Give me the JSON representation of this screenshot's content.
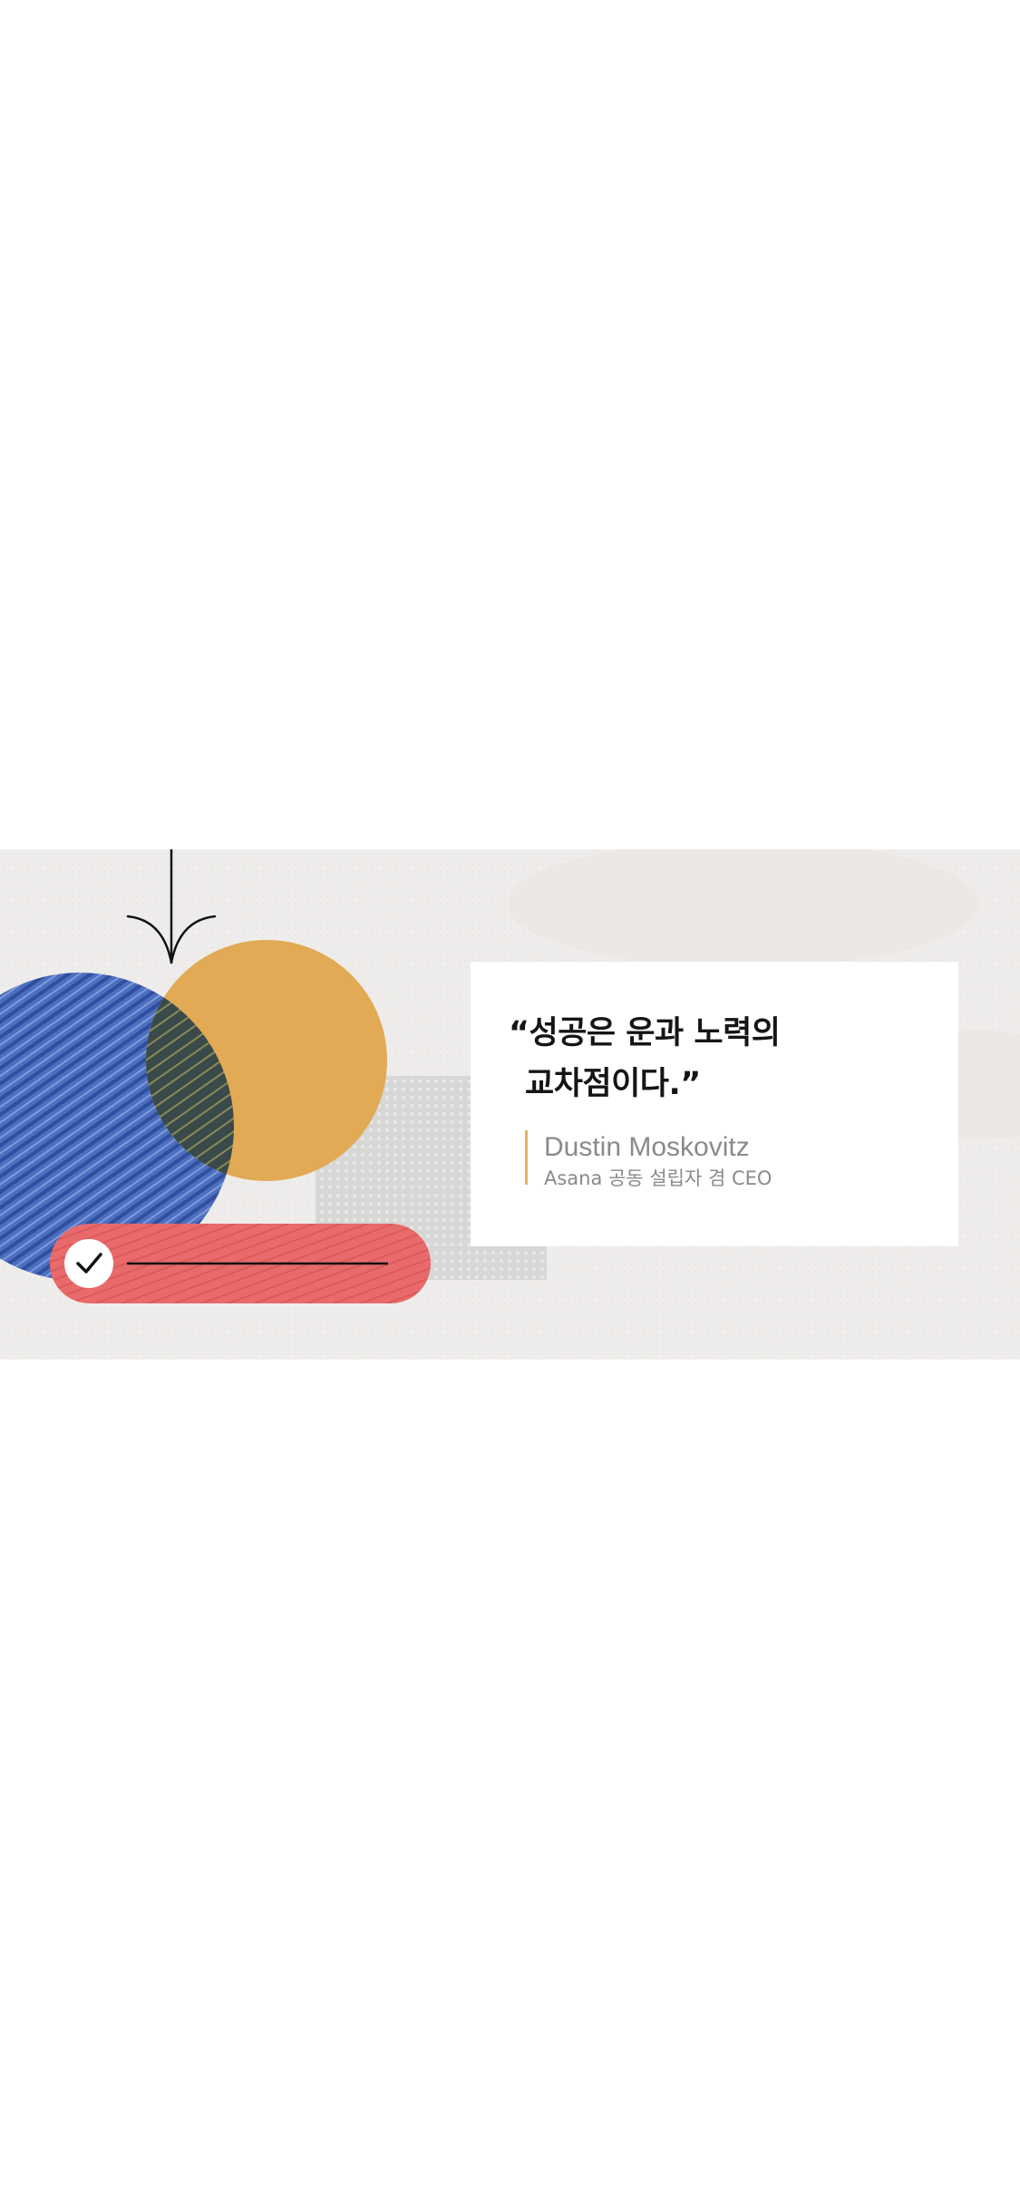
{
  "quote": {
    "line1": "“성공은 운과 노력의",
    "line2": "교차점이다.”"
  },
  "attribution": {
    "name": "Dustin Moskovitz",
    "title": "Asana 공동 설립자 겸 CEO"
  },
  "illustration": {
    "icons": [
      "arrow-down-icon",
      "checkmark-icon"
    ]
  },
  "colors": {
    "banner_background": "#efedec",
    "blue_circle": "#4d6fc0",
    "orange_circle": "#e2aa55",
    "overlap": "#3a4a4a",
    "red_pill": "#e86a6a",
    "accent_bar": "#e4b45b",
    "quote_text": "#151515",
    "author_text": "#8a8a8a"
  }
}
